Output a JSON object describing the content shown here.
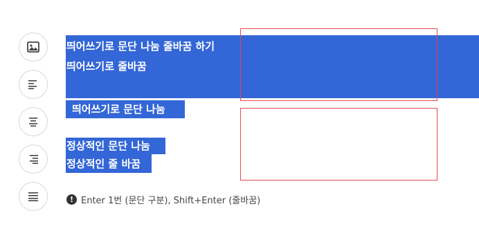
{
  "toolbar": {
    "buttons": [
      {
        "icon": "image-icon"
      },
      {
        "icon": "align-left-icon"
      },
      {
        "icon": "align-center-icon"
      },
      {
        "icon": "align-right-icon"
      },
      {
        "icon": "align-justify-icon"
      }
    ]
  },
  "editor": {
    "block1": {
      "line1": "띄어쓰기로 문단 나눔 줄바꿈 하기",
      "line2": "띄어쓰기로 줄바꿈"
    },
    "block2": {
      "line1": "띄어쓰기로 문단 나눔"
    },
    "block3": {
      "line1": "정상적인 문단 나눔",
      "line2": "정상적인 줄 바꿈"
    }
  },
  "hint": {
    "icon": "!",
    "text": "Enter 1번 (문단 구분), Shift+Enter (줄바꿈)"
  },
  "colors": {
    "selection": "#3366d6",
    "annotation_box": "#e8474c"
  }
}
